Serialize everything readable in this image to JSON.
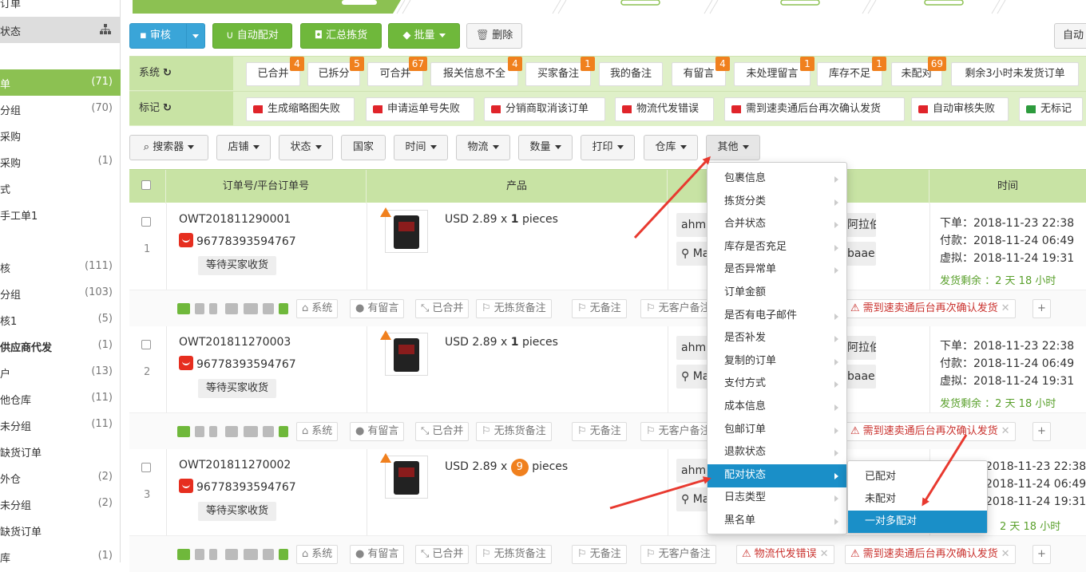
{
  "sidebar": {
    "items": [
      {
        "label": "订单",
        "count": ""
      },
      {
        "label": "状态",
        "count": ""
      },
      {
        "label": "单",
        "count": "(71)"
      },
      {
        "label": "分组",
        "count": "(70)"
      },
      {
        "label": "采购",
        "count": ""
      },
      {
        "label": "采购",
        "count": "(1)"
      },
      {
        "label": "式",
        "count": ""
      },
      {
        "label": "手工单1",
        "count": ""
      },
      {
        "label": "核",
        "count": "(111)"
      },
      {
        "label": "分组",
        "count": "(103)"
      },
      {
        "label": "核1",
        "count": "(5)"
      },
      {
        "label": "供应商代发",
        "count": "(1)"
      },
      {
        "label": "户",
        "count": "(13)"
      },
      {
        "label": "他仓库",
        "count": "(11)"
      },
      {
        "label": "未分组",
        "count": "(11)"
      },
      {
        "label": "缺货订单",
        "count": ""
      },
      {
        "label": "外仓",
        "count": "(2)"
      },
      {
        "label": "未分组",
        "count": "(2)"
      },
      {
        "label": "缺货订单",
        "count": ""
      },
      {
        "label": "库",
        "count": "(1)"
      }
    ]
  },
  "toolbar": {
    "audit": "审核",
    "auto_match": "自动配对",
    "summary_pick": "汇总拣货",
    "batch": "批量",
    "delete": "删除",
    "right_btn": "自动"
  },
  "system_filter": {
    "label": "系统",
    "chips": [
      {
        "label": "已合并",
        "badge": "4"
      },
      {
        "label": "已拆分",
        "badge": "5"
      },
      {
        "label": "可合并",
        "badge": "67"
      },
      {
        "label": "报关信息不全",
        "badge": "4"
      },
      {
        "label": "买家备注",
        "badge": "1"
      },
      {
        "label": "我的备注",
        "badge": ""
      },
      {
        "label": "有留言",
        "badge": "4"
      },
      {
        "label": "未处理留言",
        "badge": "1"
      },
      {
        "label": "库存不足",
        "badge": "1"
      },
      {
        "label": "未配对",
        "badge": "69"
      },
      {
        "label": "剩余3小时未发货订单",
        "badge": ""
      }
    ]
  },
  "mark_filter": {
    "label": "标记",
    "tags": [
      {
        "label": "生成缩略图失败",
        "color": "#e0242a"
      },
      {
        "label": "申请运单号失败",
        "color": "#e0242a"
      },
      {
        "label": "分销商取消该订单",
        "color": "#e0242a"
      },
      {
        "label": "物流代发错误",
        "color": "#e0242a"
      },
      {
        "label": "需到速卖通后台再次确认发货",
        "color": "#e0242a"
      },
      {
        "label": "自动审核失败",
        "color": "#e0242a"
      },
      {
        "label": "无标记",
        "color": "#2d9b3d"
      }
    ]
  },
  "search_bar": {
    "items": [
      "搜索器",
      "店铺",
      "状态",
      "国家",
      "时间",
      "物流",
      "数量",
      "打印",
      "仓库",
      "其他"
    ]
  },
  "table": {
    "headers": [
      "订单号/平台订单号",
      "产品",
      "",
      "时间"
    ],
    "rows": [
      {
        "index": "1",
        "order_no": "OWT201811290001",
        "platform_no": "96778393594767",
        "status": "等待买家收货",
        "price": "USD 2.89 x",
        "qty": "1",
        "unit": "pieces",
        "qty_badge": false,
        "buyer": "ahmad",
        "buyer_extra": "阿拉伯",
        "country": "Ma",
        "country_extra": "baae",
        "t_order_label": "下单：",
        "t_order": "2018-11-23 22:38",
        "t_pay_label": "付款：",
        "t_pay": "2018-11-24 06:49",
        "t_virt_label": "虚拟：",
        "t_virt": "2018-11-24 19:31",
        "remain": "发货剩余 ：2 天 18 小时",
        "actions": [
          "系统",
          "有留言",
          "已合并",
          "无拣货备注",
          "无备注",
          "无客户备注"
        ],
        "red_actions": [
          "需到速卖通后台再次确认发货"
        ]
      },
      {
        "index": "2",
        "order_no": "OWT201811270003",
        "platform_no": "96778393594767",
        "status": "等待买家收货",
        "price": "USD 2.89 x",
        "qty": "1",
        "unit": "pieces",
        "qty_badge": false,
        "buyer": "ahmad",
        "buyer_extra": "阿拉伯",
        "country": "Ma",
        "country_extra": "baae",
        "t_order_label": "下单：",
        "t_order": "2018-11-23 22:38",
        "t_pay_label": "付款：",
        "t_pay": "2018-11-24 06:49",
        "t_virt_label": "虚拟：",
        "t_virt": "2018-11-24 19:31",
        "remain": "发货剩余 ：2 天 18 小时",
        "actions": [
          "系统",
          "有留言",
          "已合并",
          "无拣货备注",
          "无备注",
          "无客户备注"
        ],
        "red_actions": [
          "需到速卖通后台再次确认发货"
        ]
      },
      {
        "index": "3",
        "order_no": "OWT201811270002",
        "platform_no": "96778393594767",
        "status": "等待买家收货",
        "price": "USD 2.89 x",
        "qty": "9",
        "unit": "pieces",
        "qty_badge": true,
        "buyer": "ahmad",
        "buyer_extra": "",
        "country": "Ma",
        "country_extra": "",
        "t_order_label": "",
        "t_order": "2018-11-23 22:38",
        "t_pay_label": "",
        "t_pay": "2018-11-24 06:49",
        "t_virt_label": "",
        "t_virt": "2018-11-24 19:31",
        "remain": "2 天 18 小时",
        "actions": [
          "系统",
          "有留言",
          "已合并",
          "无拣货备注",
          "无备注",
          "无客户备注"
        ],
        "red_actions": [
          "物流代发错误",
          "需到速卖通后台再次确认发货"
        ]
      }
    ]
  },
  "other_menu": {
    "items": [
      "包裹信息",
      "拣货分类",
      "合并状态",
      "库存是否充足",
      "是否异常单",
      "订单金额",
      "是否有电子邮件",
      "是否补发",
      "复制的订单",
      "支付方式",
      "成本信息",
      "包邮订单",
      "退款状态",
      "配对状态",
      "日志类型",
      "黑名单"
    ],
    "active_index": 13
  },
  "match_submenu": {
    "items": [
      "已配对",
      "未配对",
      "一对多配对"
    ],
    "active_index": 2
  },
  "colors": {
    "green_btn": "#6fb83b",
    "blue_btn": "#3aa5d8",
    "filter_bg": "#dff0c8",
    "badge": "#f0801e",
    "menu_active": "#1a8fc8",
    "arrow": "#e8392f"
  }
}
